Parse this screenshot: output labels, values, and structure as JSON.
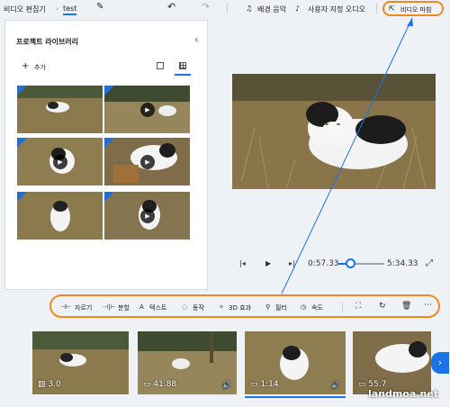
{
  "header": {
    "app_name": "비디오 편집기",
    "project_name": "test",
    "pencil_icon": "pencil-icon",
    "undo_icon": "undo-icon",
    "redo_icon": "redo-icon",
    "bg_music_label": "배경 음악",
    "custom_audio_label": "사용자 지정 오디오",
    "finish_label": "비디오 마침"
  },
  "library": {
    "title": "프로젝트 라이브러리",
    "add_label": "추가",
    "collapse_icon": "chevron-left-icon",
    "view_small_icon": "grid-small-icon",
    "view_large_icon": "grid-large-icon"
  },
  "playback": {
    "current_time": "0:57.33",
    "total_time": "5:34.33",
    "progress": 0.17
  },
  "storyboard_toolbar": {
    "items": [
      "자르기",
      "분할",
      "텍스트",
      "동작",
      "3D 효과",
      "필터",
      "속도"
    ]
  },
  "clips": [
    {
      "duration": "3.0",
      "icon": "image-icon",
      "has_audio": false
    },
    {
      "duration": "41.88",
      "icon": "video-icon",
      "has_audio": true
    },
    {
      "duration": "1:14",
      "icon": "video-icon",
      "has_audio": true
    },
    {
      "duration": "55.7",
      "icon": "video-icon",
      "has_audio": false
    }
  ],
  "watermark": "landmoa.net",
  "colors": {
    "accent": "#1a73e8",
    "highlight_outline": "#f08a1c",
    "background": "#eef1f6"
  }
}
